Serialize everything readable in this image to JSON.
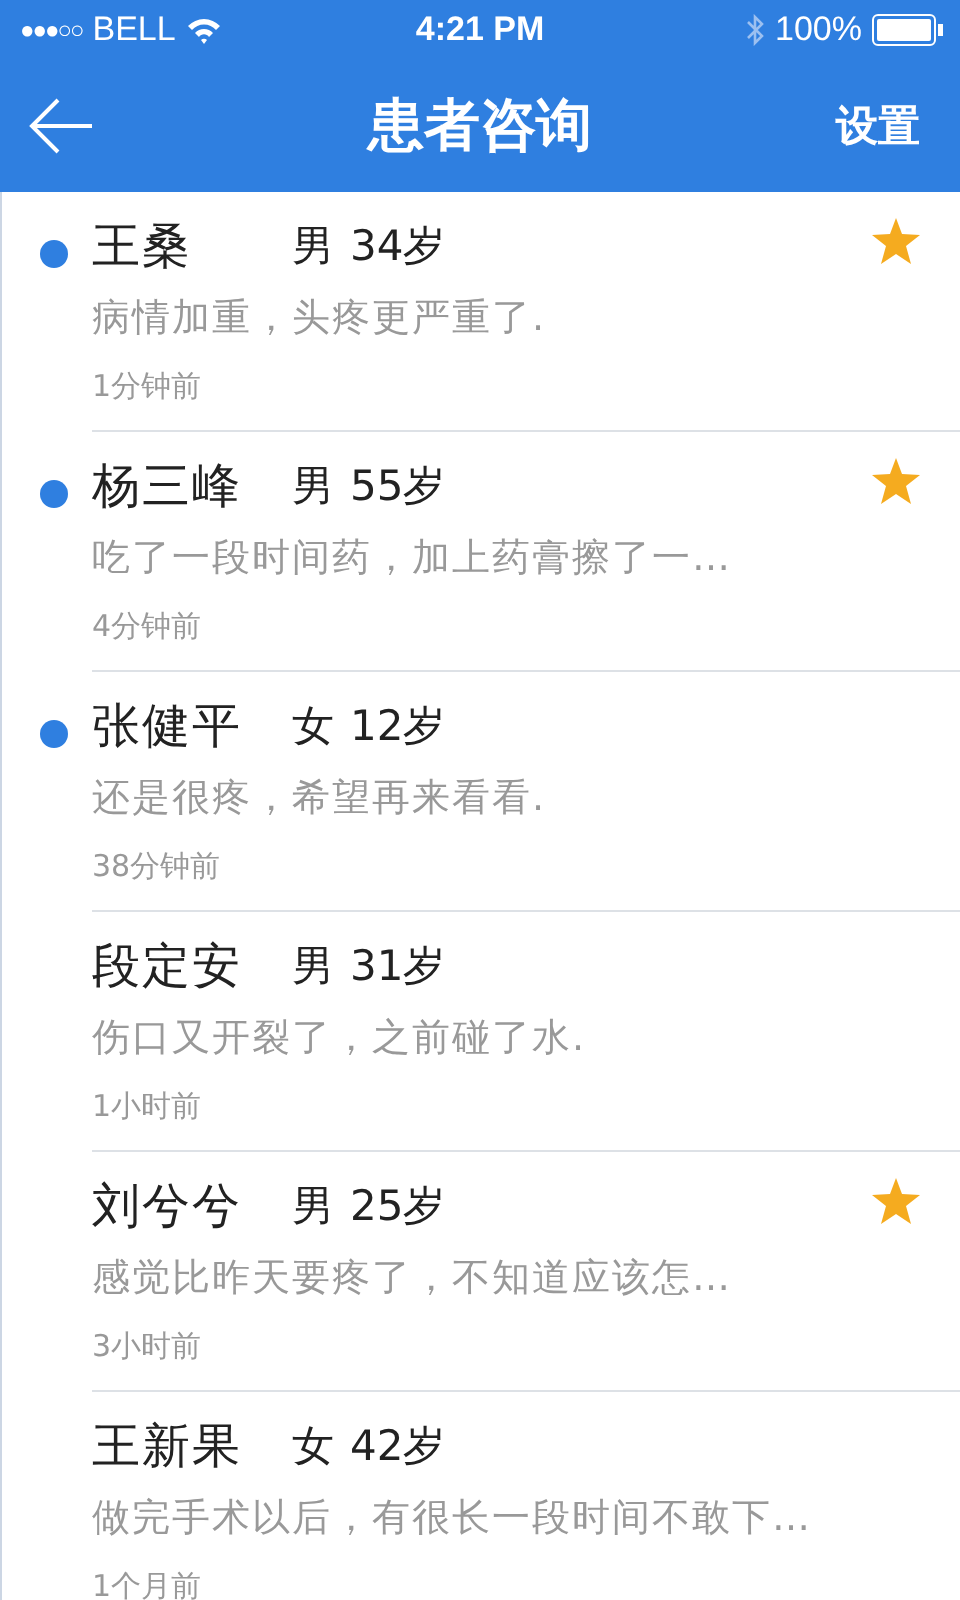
{
  "status_bar": {
    "signal": "●●●○○",
    "carrier": "BELL",
    "time": "4:21 PM",
    "battery": "100%"
  },
  "nav": {
    "title": "患者咨询",
    "action": "设置"
  },
  "patients": [
    {
      "name": "王桑",
      "gender": "男",
      "age": "34岁",
      "message": "病情加重，头疼更严重了.",
      "time": "1分钟前",
      "unread": true,
      "starred": true
    },
    {
      "name": "杨三峰",
      "gender": "男",
      "age": "55岁",
      "message": "吃了一段时间药，加上药膏擦了一…",
      "time": "4分钟前",
      "unread": true,
      "starred": true
    },
    {
      "name": "张健平",
      "gender": "女",
      "age": "12岁",
      "message": "还是很疼，希望再来看看.",
      "time": "38分钟前",
      "unread": true,
      "starred": false
    },
    {
      "name": "段定安",
      "gender": "男",
      "age": "31岁",
      "message": "伤口又开裂了，之前碰了水.",
      "time": "1小时前",
      "unread": false,
      "starred": false
    },
    {
      "name": "刘兮兮",
      "gender": "男",
      "age": "25岁",
      "message": "感觉比昨天要疼了，不知道应该怎…",
      "time": "3小时前",
      "unread": false,
      "starred": true
    },
    {
      "name": "王新果",
      "gender": "女",
      "age": "42岁",
      "message": "做完手术以后，有很长一段时间不敢下…",
      "time": "1个月前",
      "unread": false,
      "starred": false
    }
  ]
}
